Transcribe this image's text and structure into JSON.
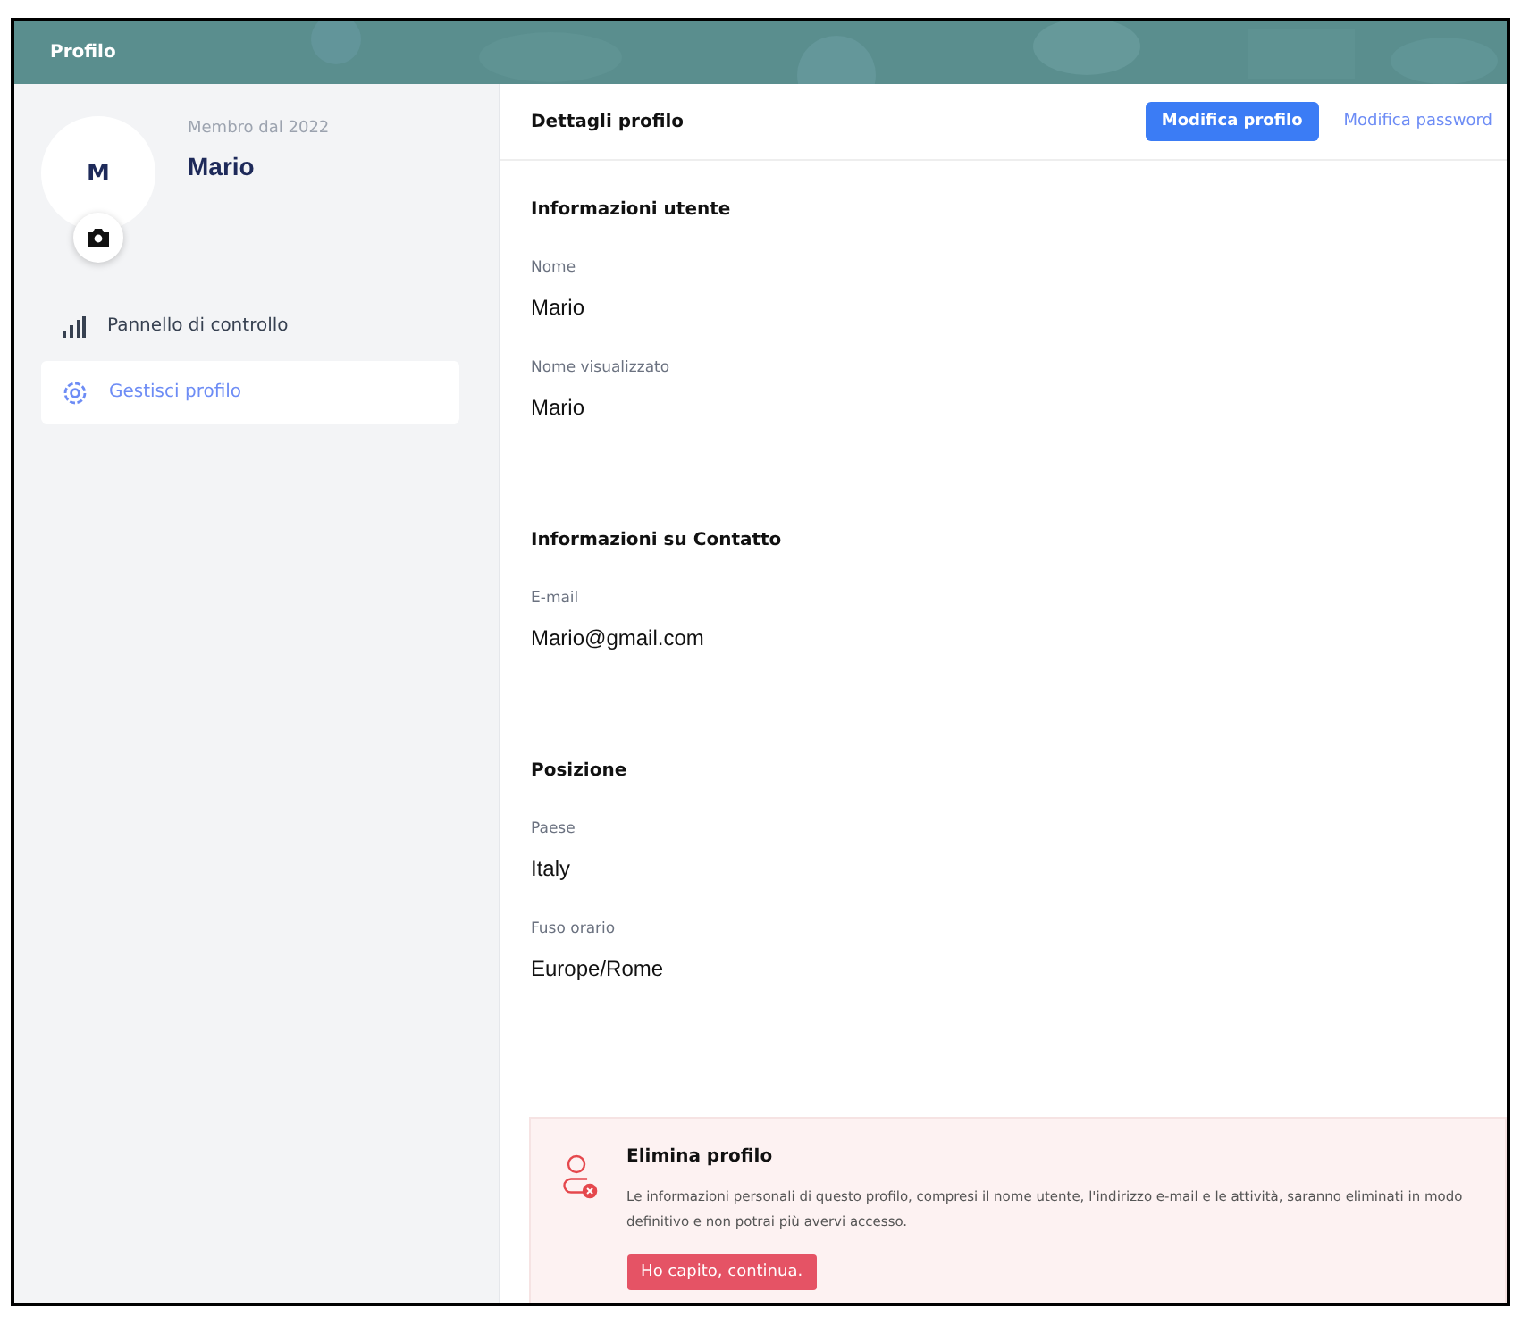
{
  "header": {
    "title": "Profilo"
  },
  "profile": {
    "initial": "M",
    "member_since": "Membro dal 2022",
    "name": "Mario"
  },
  "sidebar": {
    "items": [
      {
        "label": "Pannello di controllo",
        "kind": "chart",
        "selected": false
      },
      {
        "label": "Gestisci profilo",
        "kind": "gear",
        "selected": true
      }
    ]
  },
  "details": {
    "title": "Dettagli profilo",
    "edit_button": "Modifica profilo",
    "password_link": "Modifica password",
    "sections": [
      {
        "title": "Informazioni utente",
        "fields": [
          {
            "label": "Nome",
            "value": "Mario"
          },
          {
            "label": "Nome visualizzato",
            "value": "Mario"
          }
        ]
      },
      {
        "title": "Informazioni su Contatto",
        "fields": [
          {
            "label": "E-mail",
            "value": "Mario@gmail.com"
          }
        ]
      },
      {
        "title": "Posizione",
        "fields": [
          {
            "label": "Paese",
            "value": "Italy"
          },
          {
            "label": "Fuso orario",
            "value": "Europe/Rome"
          }
        ]
      }
    ]
  },
  "delete": {
    "title": "Elimina profilo",
    "text": "Le informazioni personali di questo profilo, compresi il nome utente, l'indirizzo e-mail e le attività, saranno eliminati in modo definitivo e non potrai più avervi accesso.",
    "button": "Ho capito, continua."
  }
}
